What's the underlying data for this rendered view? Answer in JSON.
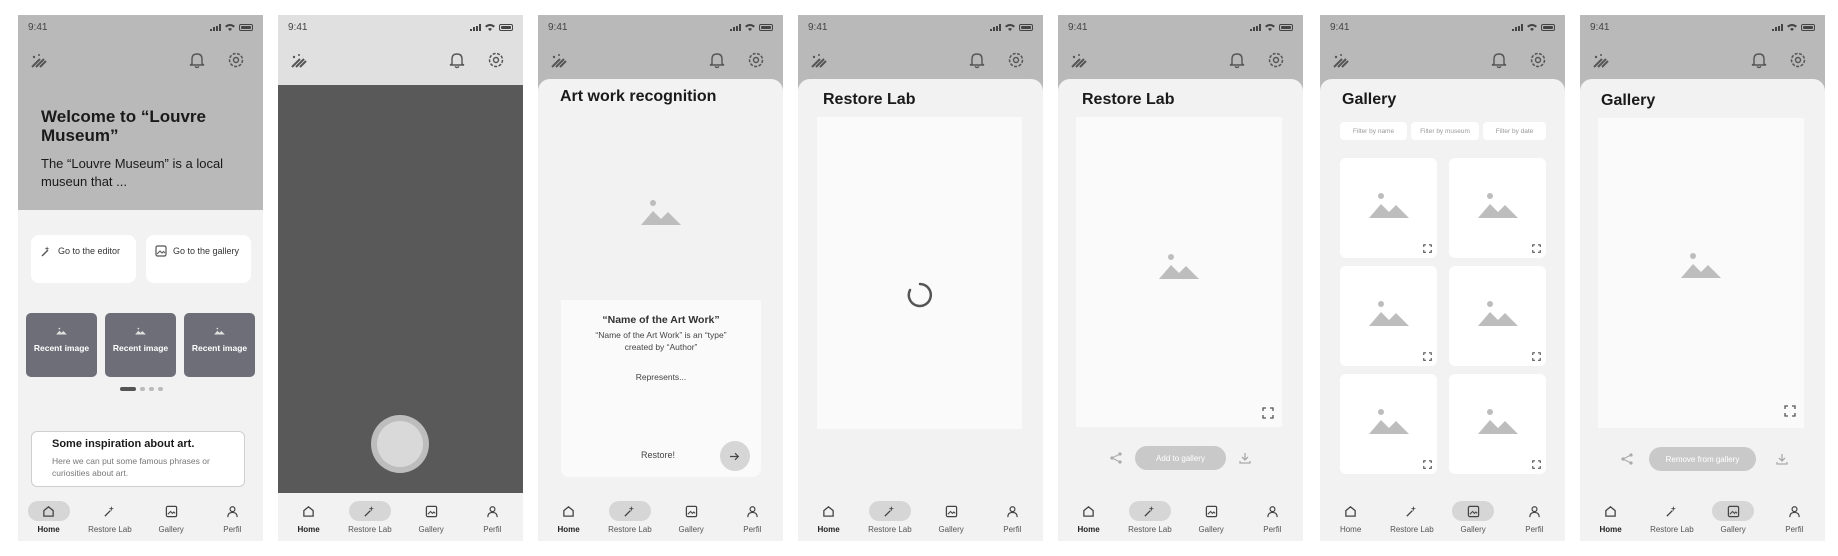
{
  "status_time": "9:41",
  "nav": {
    "home": "Home",
    "restore": "Restore Lab",
    "gallery": "Gallery",
    "profile": "Perfil"
  },
  "home": {
    "welcome_title": "Welcome to “Louvre Museum”",
    "welcome_text": "The “Louvre Museum” is a local museun that ...",
    "go_editor": "Go to the editor",
    "go_gallery": "Go to the gallery",
    "recent": [
      "Recent image",
      "Recent image",
      "Recent image"
    ],
    "carousel_dots": 4,
    "carousel_active": 1,
    "inspiration_title": "Some inspiration about art.",
    "inspiration_text": "Here we can put some famous phrases or curiosities about art."
  },
  "camera": {
    "shutter_icon": "shutter-button"
  },
  "recognition": {
    "title": "Art work recognition",
    "name": "“Name of the Art Work”",
    "desc": "“Name of the Art Work” is an “type” created by “Author”",
    "represents": "Represents...",
    "restore": "Restore!"
  },
  "restore_loading": {
    "title": "Restore Lab"
  },
  "restore_result": {
    "title": "Restore Lab",
    "add_to_gallery": "Add to gallery"
  },
  "gallery": {
    "title": "Gallery",
    "filters": [
      "Filter by name",
      "Filter by museum",
      "Filter by date"
    ],
    "items": 6
  },
  "gallery_detail": {
    "title": "Gallery",
    "remove": "Remove from gallery"
  },
  "colors": {
    "header_gray": "#b9b9b9",
    "dark_camera": "#595959",
    "recent_card": "#6e6e78",
    "bg": "#f2f2f2"
  }
}
